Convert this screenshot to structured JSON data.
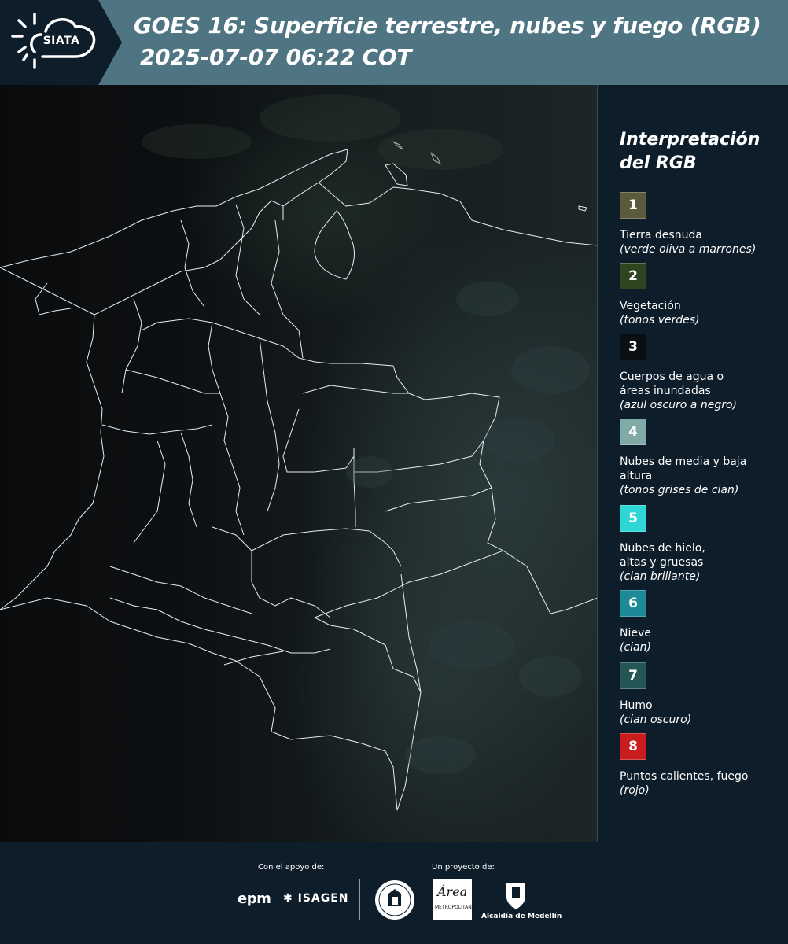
{
  "header": {
    "logo_text": "SIATA",
    "title_line1": "GOES 16: Superficie terrestre, nubes y fuego (RGB)",
    "title_line2": "2025-07-07 06:22 COT",
    "background_color": "#4f7583"
  },
  "legend": {
    "title_line1": "Interpretación",
    "title_line2": "del RGB",
    "items": [
      {
        "number": "1",
        "color": "#5c5a3d",
        "label": "Tierra desnuda",
        "desc": "(verde oliva a marrones)"
      },
      {
        "number": "2",
        "color": "#2e4520",
        "label": "Vegetación",
        "desc": "(tonos verdes)"
      },
      {
        "number": "3",
        "color": "#0a0f14",
        "label": "Cuerpos de agua o áreas inundadas",
        "desc": "(azul oscuro a negro)"
      },
      {
        "number": "4",
        "color": "#80aaa7",
        "label": "Nubes de media y baja altura",
        "desc": "(tonos grises de cian)"
      },
      {
        "number": "5",
        "color": "#2fd6d6",
        "label": "Nubes de hielo, altas y gruesas",
        "desc": "(cian brillante)"
      },
      {
        "number": "6",
        "color": "#1e8a98",
        "label": "Nieve",
        "desc": "(cian)"
      },
      {
        "number": "7",
        "color": "#245655",
        "label": "Humo",
        "desc": "(cian oscuro)"
      },
      {
        "number": "8",
        "color": "#c91c1c",
        "label": "Puntos calientes, fuego",
        "desc": "(rojo)"
      }
    ]
  },
  "footer": {
    "support_caption": "Con el apoyo de:",
    "project_caption": "Un proyecto de:",
    "epm_logo": "epm",
    "isagen_logo": "ISAGEN",
    "area_logo_script": "Área",
    "area_logo_sub": "METROPOLITANA",
    "alcaldia_text": "Alcaldía de Medellín"
  }
}
